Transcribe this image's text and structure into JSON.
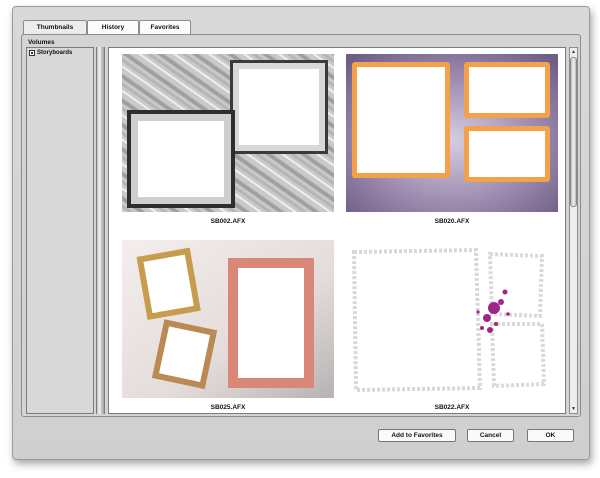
{
  "tabs": [
    {
      "label": "Thumbnails",
      "active": true
    },
    {
      "label": "History",
      "active": false
    },
    {
      "label": "Favorites",
      "active": false
    }
  ],
  "sidebar": {
    "header": "Volumes",
    "items": [
      {
        "label": "Storyboards",
        "icon": "folder-icon"
      }
    ]
  },
  "thumbnails": [
    {
      "caption": "SB002.AFX",
      "style": "silver grunge frames on grey"
    },
    {
      "caption": "SB020.AFX",
      "style": "orange glowing frames on purple"
    },
    {
      "caption": "SB025.AFX",
      "style": "gold and pink frames on marble"
    },
    {
      "caption": "SB022.AFX",
      "style": "white torn frames with magenta splatter"
    }
  ],
  "buttons": {
    "add_favorites": "Add to Favorites",
    "cancel": "Cancel",
    "ok": "OK"
  },
  "colors": {
    "window_bg": "#d4d4d4",
    "purple_bg": "#8a7a9e",
    "orange_frame": "#f0a040",
    "pink_frame": "#d98776",
    "gold_frame": "#c8a050",
    "magenta_splatter": "#a0258a"
  }
}
